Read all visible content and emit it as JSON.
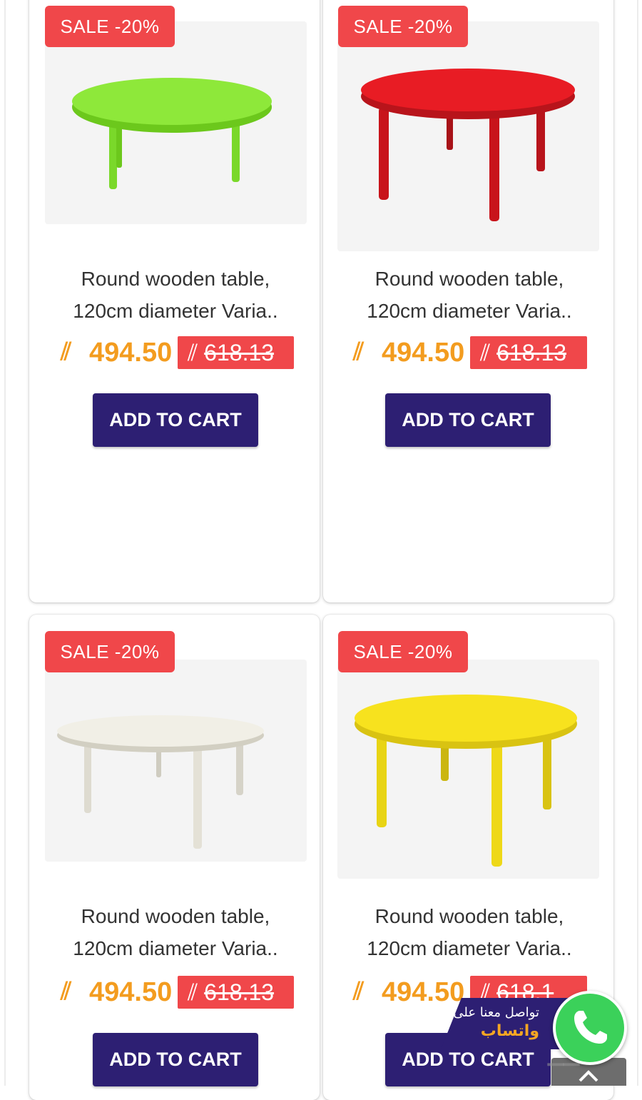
{
  "products": [
    {
      "sale_label": "SALE -20%",
      "title_line1": "Round wooden table,",
      "title_line2": "120cm diameter Varia..",
      "currency_symbol": "⫽",
      "price_new": "494.50",
      "price_old": "618.13",
      "cart_label": "ADD TO CART",
      "table_color": "#8ee83a",
      "table_edge": "#6cc81c"
    },
    {
      "sale_label": "SALE -20%",
      "title_line1": "Round wooden table,",
      "title_line2": "120cm diameter Varia..",
      "currency_symbol": "⫽",
      "price_new": "494.50",
      "price_old": "618.13",
      "cart_label": "ADD TO CART",
      "table_color": "#e81c24",
      "table_edge": "#b8141b"
    },
    {
      "sale_label": "SALE -20%",
      "title_line1": "Round wooden table,",
      "title_line2": "120cm diameter Varia..",
      "currency_symbol": "⫽",
      "price_new": "494.50",
      "price_old": "618.13",
      "cart_label": "ADD TO CART",
      "table_color": "#f1efe6",
      "table_edge": "#d2cfc2"
    },
    {
      "sale_label": "SALE -20%",
      "title_line1": "Round wooden table,",
      "title_line2": "120cm diameter Varia..",
      "currency_symbol": "⫽",
      "price_new": "494.50",
      "price_old": "618.1",
      "cart_label": "ADD TO CART",
      "table_color": "#f7e21e",
      "table_edge": "#d9c312"
    }
  ],
  "whatsapp": {
    "line1": "تواصل معنا على",
    "line2": "واتساب",
    "icon": "whatsapp-phone-icon",
    "color": "#3bd15a"
  },
  "colors": {
    "sale_badge": "#f0474a",
    "price": "#f39c1f",
    "button": "#2d1f73"
  }
}
